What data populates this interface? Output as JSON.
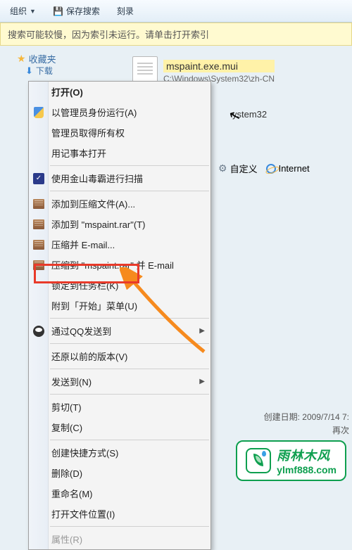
{
  "toolbar": {
    "organize": "组织",
    "save_search": "保存搜索",
    "burn": "刻录"
  },
  "infobar": {
    "text": "搜索可能较慢，因为索引未运行。请单击打开索引"
  },
  "sidebar": {
    "favorites": "收藏夹",
    "downloads": "下载"
  },
  "file": {
    "name": "mspaint.exe.mui",
    "path": "C:\\Windows\\System32\\zh-CN"
  },
  "folder_entry": "ystem32",
  "bottom_links": {
    "customize": "自定义",
    "internet": "Internet"
  },
  "details": {
    "created_label": "创建日期:",
    "created_value": "2009/7/14 7:",
    "again_label": "再次"
  },
  "menu": {
    "open": "打开(O)",
    "run_as_admin": "以管理员身份运行(A)",
    "admin_ownership": "管理员取得所有权",
    "open_notepad": "用记事本打开",
    "scan_jinshan": "使用金山毒霸进行扫描",
    "add_to_archive": "添加到压缩文件(A)...",
    "add_to_rar": "添加到 \"mspaint.rar\"(T)",
    "compress_email": "压缩并 E-mail...",
    "compress_rar_email": "压缩到 \"mspaint.rar\" 并 E-mail",
    "pin_taskbar": "锁定到任务栏(K)",
    "pin_start": "附到「开始」菜单(U)",
    "send_qq": "通过QQ发送到",
    "restore_prev": "还原以前的版本(V)",
    "send_to": "发送到(N)",
    "cut": "剪切(T)",
    "copy": "复制(C)",
    "create_shortcut": "创建快捷方式(S)",
    "delete": "删除(D)",
    "rename": "重命名(M)",
    "open_location": "打开文件位置(I)",
    "properties": "属性(R)"
  },
  "watermark": {
    "title": "雨林木风",
    "url": "ylmf888.com"
  }
}
